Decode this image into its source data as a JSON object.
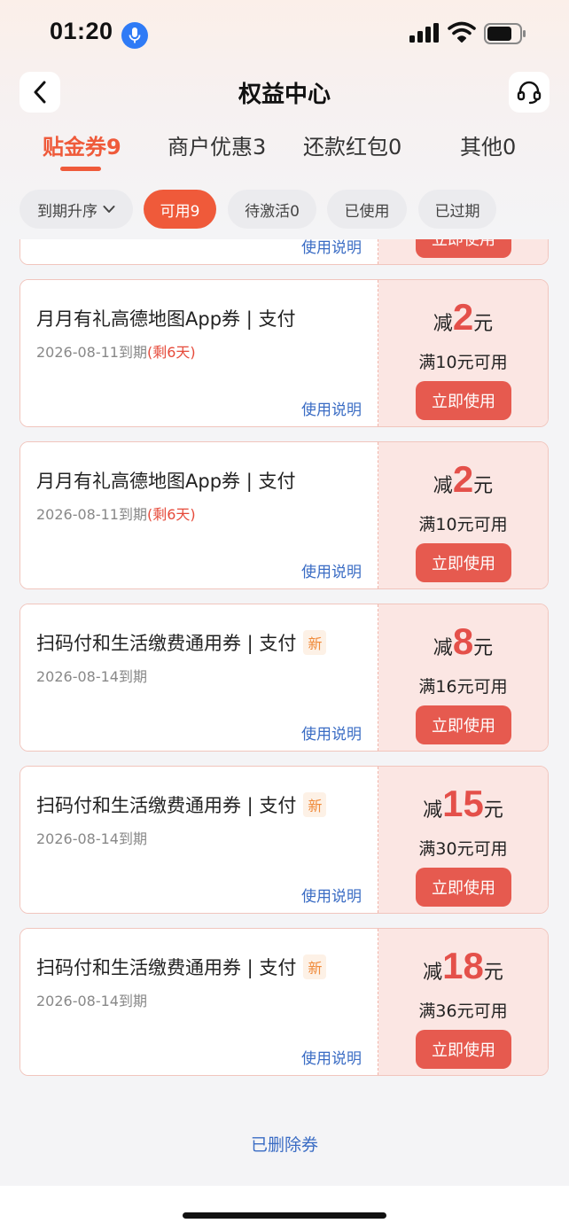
{
  "status_bar": {
    "time": "01:20"
  },
  "header": {
    "title": "权益中心"
  },
  "tabs": [
    {
      "label": "贴金券9"
    },
    {
      "label": "商户优惠3"
    },
    {
      "label": "还款红包0"
    },
    {
      "label": "其他0"
    }
  ],
  "filters": [
    {
      "label": "到期升序"
    },
    {
      "label": "可用9"
    },
    {
      "label": "待激活0"
    },
    {
      "label": "已使用"
    },
    {
      "label": "已过期"
    }
  ],
  "coupons": [
    {
      "title": "",
      "expiry": "",
      "remain": "",
      "usage": "使用说明",
      "pre": "",
      "amount": "",
      "unit": "",
      "threshold": "",
      "button": "立即使用"
    },
    {
      "title": "月月有礼高德地图App券 | 支付",
      "expiry": "2026-08-11到期",
      "remain": "(剩6天)",
      "usage": "使用说明",
      "pre": "减",
      "amount": "2",
      "unit": "元",
      "threshold": "满10元可用",
      "button": "立即使用"
    },
    {
      "title": "月月有礼高德地图App券 | 支付",
      "expiry": "2026-08-11到期",
      "remain": "(剩6天)",
      "usage": "使用说明",
      "pre": "减",
      "amount": "2",
      "unit": "元",
      "threshold": "满10元可用",
      "button": "立即使用"
    },
    {
      "title": "扫码付和生活缴费通用券 | 支付",
      "badge": "新",
      "expiry": "2026-08-14到期",
      "usage": "使用说明",
      "pre": "减",
      "amount": "8",
      "unit": "元",
      "threshold": "满16元可用",
      "button": "立即使用"
    },
    {
      "title": "扫码付和生活缴费通用券 | 支付",
      "badge": "新",
      "expiry": "2026-08-14到期",
      "usage": "使用说明",
      "pre": "减",
      "amount": "15",
      "unit": "元",
      "threshold": "满30元可用",
      "button": "立即使用"
    },
    {
      "title": "扫码付和生活缴费通用券 | 支付",
      "badge": "新",
      "expiry": "2026-08-14到期",
      "usage": "使用说明",
      "pre": "减",
      "amount": "18",
      "unit": "元",
      "threshold": "满36元可用",
      "button": "立即使用"
    }
  ],
  "footer": {
    "deleted_link": "已删除券"
  },
  "colors": {
    "accent": "#ef5a3a",
    "link": "#3a6cc4",
    "coupon_bg": "#fbe6e3"
  }
}
